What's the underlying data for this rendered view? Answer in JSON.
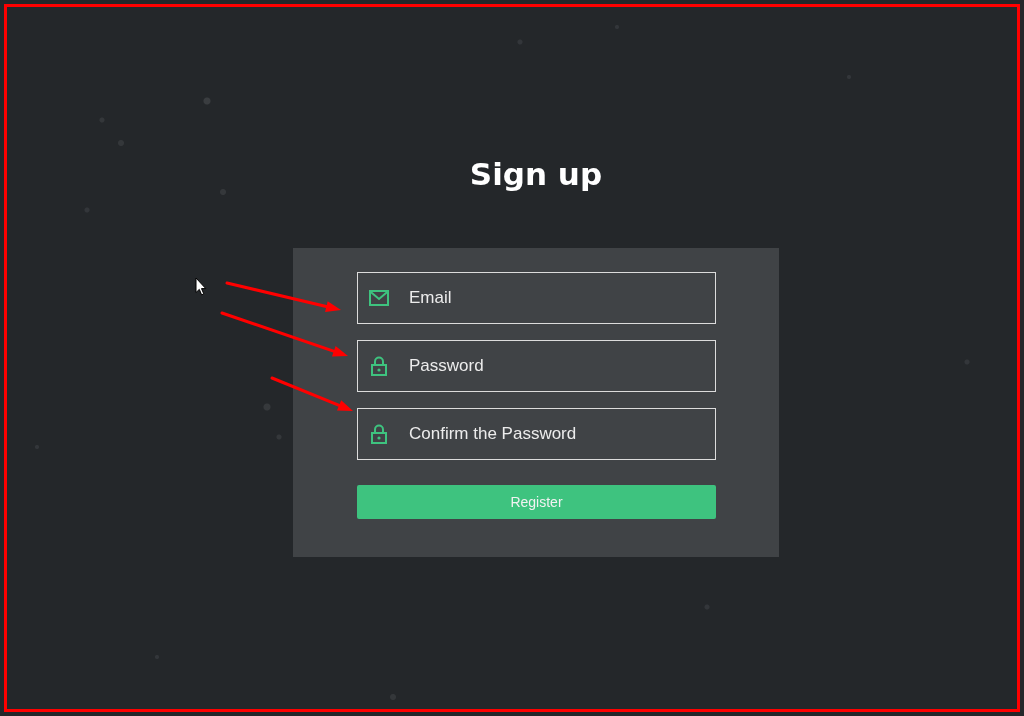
{
  "title": "Sign up",
  "form": {
    "fields": [
      {
        "kind": "email",
        "placeholder": "Email"
      },
      {
        "kind": "password",
        "placeholder": "Password"
      },
      {
        "kind": "password",
        "placeholder": "Confirm the Password"
      }
    ],
    "submit_button": {
      "label": "Register"
    }
  }
}
